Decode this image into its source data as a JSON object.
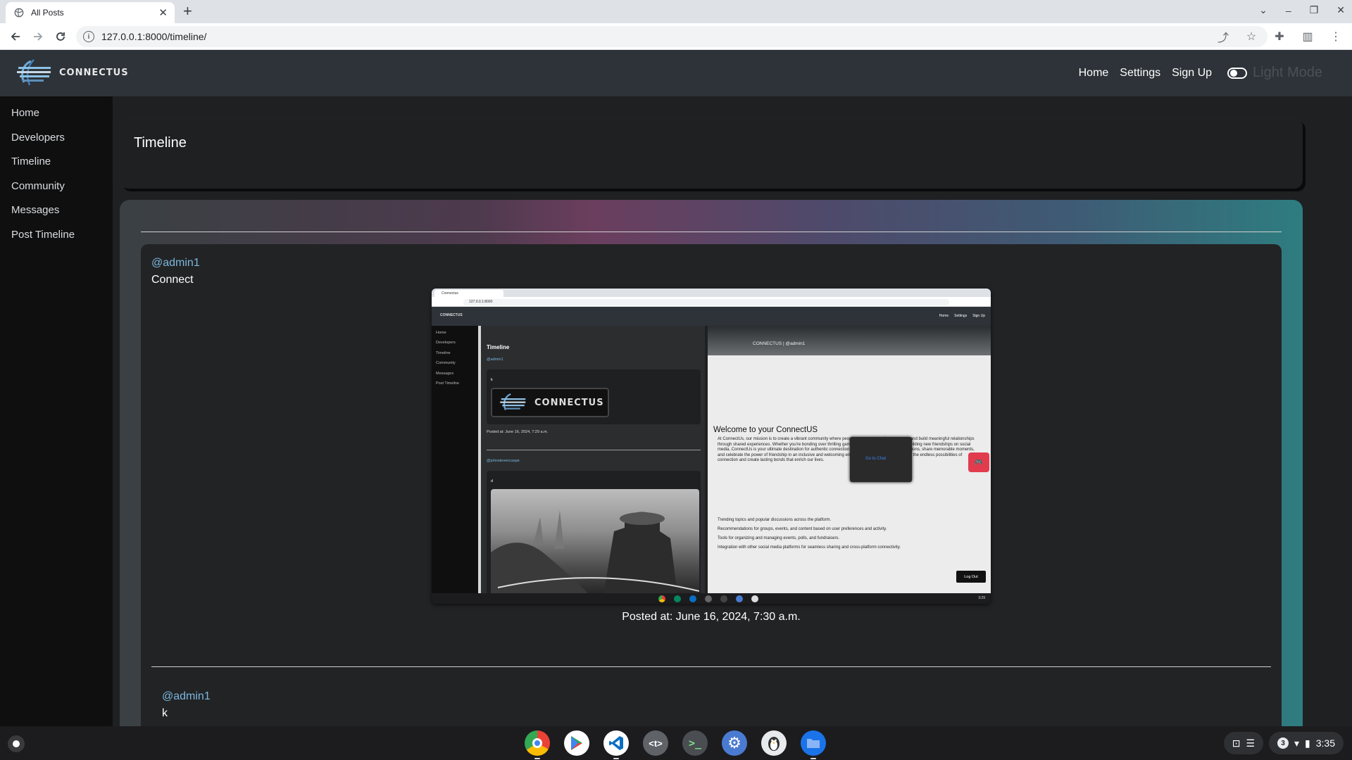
{
  "browser": {
    "tab_title": "All Posts",
    "url": "127.0.0.1:8000/timeline/"
  },
  "header": {
    "brand": "CONNECTUS",
    "nav": [
      "Home",
      "Settings",
      "Sign Up"
    ],
    "mode_label": "Light Mode"
  },
  "sidebar": {
    "items": [
      {
        "label": "Home"
      },
      {
        "label": "Developers"
      },
      {
        "label": "Timeline"
      },
      {
        "label": "Community"
      },
      {
        "label": "Messages"
      },
      {
        "label": "Post Timeline"
      }
    ]
  },
  "page": {
    "title": "Timeline"
  },
  "posts": [
    {
      "user": "@admin1",
      "text": "Connect",
      "posted": "Posted at: June 16, 2024, 7:30 a.m."
    },
    {
      "user": "@admin1",
      "text": "k"
    }
  ],
  "embedded": {
    "tab_title": "Connectus",
    "url": "127.0.0.1:8000",
    "brand": "CONNECTUS",
    "nav": [
      "Home",
      "Settings",
      "Sign Up"
    ],
    "sidebar": [
      "Home",
      "Developers",
      "Timeline",
      "Community",
      "Messages",
      "Post Timeline"
    ],
    "timeline_title": "Timeline",
    "post1_user": "@admin1",
    "post1_text": "k",
    "logo_text": "CONNECTUS",
    "post1_time": "Posted at: June 16, 2024, 7:29 a.m.",
    "post2_user": "@johnstevencaspe",
    "post2_text": "d",
    "right_brand": "CONNECTUS | @admin1",
    "welcome": "Welcome to your ConnectUS",
    "paragraph": "At ConnectUs, our mission is to create a vibrant community where people can come together, connect, and build meaningful relationships through shared experiences. Whether you're bonding over thrilling games, engaging with interests, or building new friendships on social media, ConnectUs is your ultimate destination for authentic connection. Join us to discover new connections, share memorable moments, and celebrate the power of friendship in an inclusive and welcoming environment. Together, let's explore the endless possibilities of connection and create lasting bonds that enrich our lives.",
    "features": [
      "Trending topics and popular discussions across the platform.",
      "Recommendations for groups, events, and content based on user preferences and activity.",
      "Tools for organizing and managing events, polls, and fundraisers.",
      "Integration with other social media platforms for seamless sharing and cross-platform connectivity."
    ],
    "chat_button": "Go to Chat",
    "logout_button": "Log Out",
    "clock": "3:29"
  },
  "system_tray": {
    "notification_count": "3",
    "time": "3:35"
  },
  "colors": {
    "accent_link": "#7bb8de",
    "header_bg": "#2d3338",
    "sidebar_bg": "#0f0f10"
  }
}
